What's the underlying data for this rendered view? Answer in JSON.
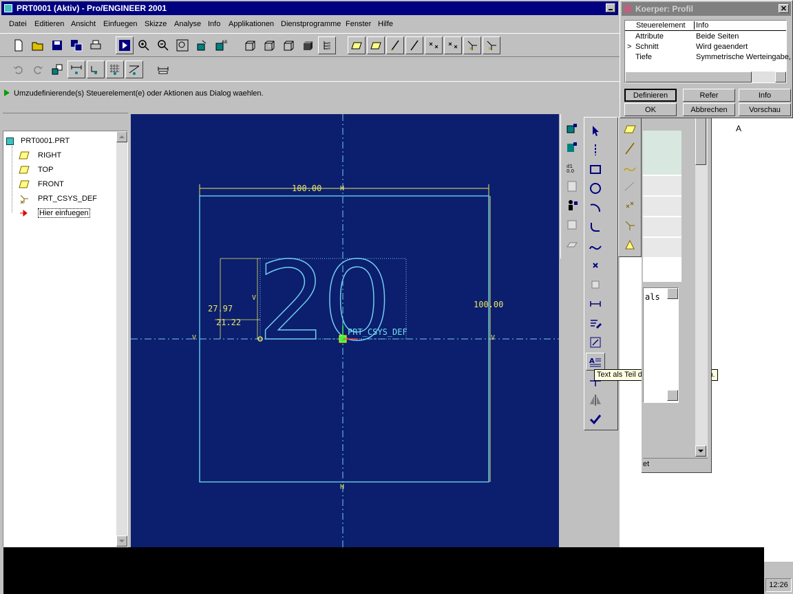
{
  "window": {
    "title": "PRT0001 (Aktiv) - Pro/ENGINEER 2001"
  },
  "menu": [
    {
      "label": "Datei"
    },
    {
      "label": "Editieren"
    },
    {
      "label": "Ansicht"
    },
    {
      "label": "Einfuegen"
    },
    {
      "label": "Skizze"
    },
    {
      "label": "Analyse"
    },
    {
      "label": "Info"
    },
    {
      "label": "Applikationen"
    },
    {
      "label": "Dienstprogramme"
    },
    {
      "label": "Fenster"
    },
    {
      "label": "Hilfe"
    }
  ],
  "status": {
    "message": "Umzudefinierende(s) Steuerelement(e) oder Aktionen aus Dialog waehlen."
  },
  "tree": {
    "root": "PRT0001.PRT",
    "items": [
      {
        "label": "RIGHT"
      },
      {
        "label": "TOP"
      },
      {
        "label": "FRONT"
      },
      {
        "label": "PRT_CSYS_DEF"
      },
      {
        "label": "Hier einfuegen"
      }
    ]
  },
  "sketch": {
    "dim_width": "100.00",
    "dim_height": "100.00",
    "dim_text_height": "27.97",
    "dim_text_offset": "21.22",
    "csys_label": "PRT_CSYS_DEF",
    "text_content": "20",
    "v_marker": "V",
    "h_marker": "H"
  },
  "tooltip": {
    "text": "Text als Teil des Schnitts erzeugen."
  },
  "dialog": {
    "title": "Koerper: Profil",
    "columns": [
      "Steuerelement",
      "Info"
    ],
    "rows": [
      {
        "element": "Attribute",
        "info": "Beide Seiten",
        "marker": ""
      },
      {
        "element": "Schnitt",
        "info": "Wird geaendert",
        "marker": ">"
      },
      {
        "element": "Tiefe",
        "info": "Symmetrische Werteingabe,",
        "marker": ""
      }
    ],
    "buttons": {
      "definieren": "Definieren",
      "refer": "Refer",
      "info": "Info",
      "ok": "OK",
      "abbrechen": "Abbrechen",
      "vorschau": "Vorschau"
    }
  },
  "side_panel": {
    "letter": "A",
    "text_fragment": "als",
    "bottom_fragment": "et"
  },
  "taskbar": {
    "clock": "12:26"
  }
}
